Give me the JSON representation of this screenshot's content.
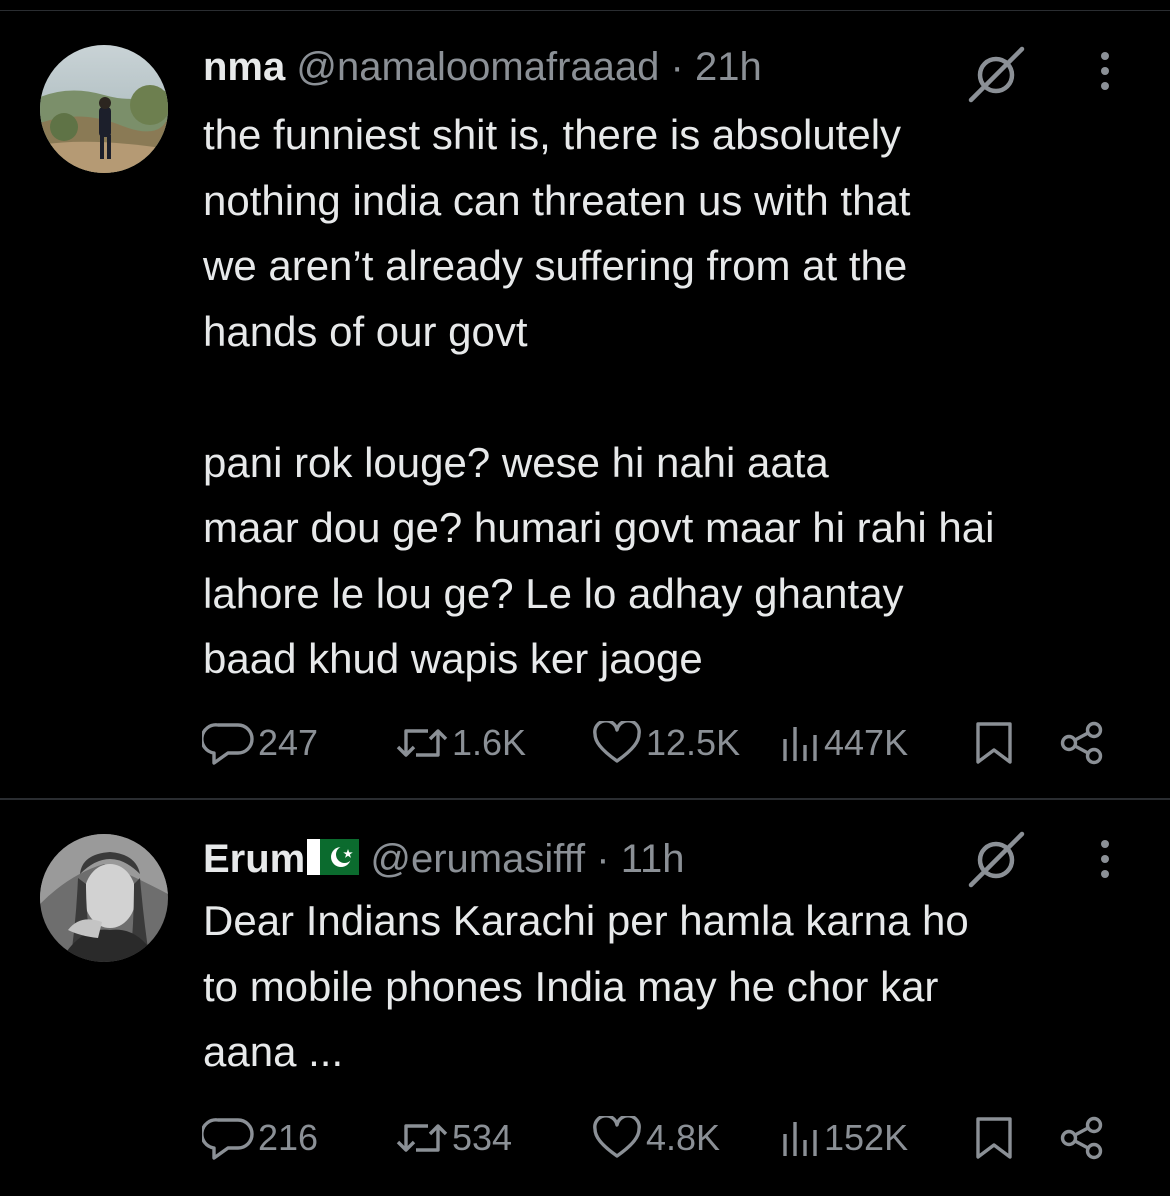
{
  "tweets": [
    {
      "display_name": "nma",
      "handle": "@namaloomafraaad",
      "separator": "·",
      "time": "21h",
      "body": "the funniest shit is, there is absolutely\nnothing india can threaten us with that\nwe aren’t already suffering from at the\nhands of our govt\n\npani rok louge? wese hi nahi aata\nmaar dou ge? humari govt maar hi rahi hai\nlahore le lou ge? Le lo adhay ghantay\nbaad khud wapis ker jaoge",
      "stats": {
        "replies": "247",
        "reposts": "1.6K",
        "likes": "12.5K",
        "views": "447K"
      }
    },
    {
      "display_name": "Erum",
      "handle": "@erumasifff",
      "separator": "·",
      "time": "11h",
      "body": "Dear Indians Karachi per hamla karna ho\nto mobile phones India may he chor kar\naana ...",
      "stats": {
        "replies": "216",
        "reposts": "534",
        "likes": "4.8K",
        "views": "152K"
      }
    }
  ],
  "icons": {
    "reply": "reply-icon",
    "repost": "repost-icon",
    "like": "heart-icon",
    "views": "views-icon",
    "bookmark": "bookmark-icon",
    "share": "share-icon",
    "grok": "grok-icon",
    "more": "more-vertical-icon",
    "flag": "pakistan-flag-icon"
  },
  "colors": {
    "background": "#000000",
    "text": "#e7e9ea",
    "muted": "#8b9096",
    "divider": "#2a2d31"
  }
}
